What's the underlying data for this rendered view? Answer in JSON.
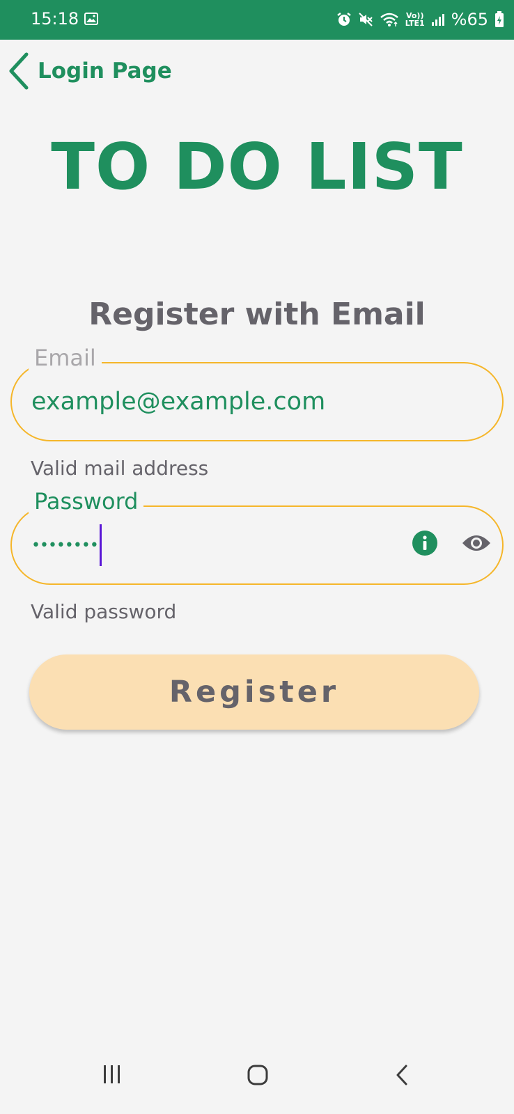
{
  "status_bar": {
    "time": "15:18",
    "volte_top": "Vo))",
    "volte_bottom": "LTE1",
    "battery": "%65",
    "icons": [
      "gallery-icon",
      "alarm-icon",
      "mute-icon",
      "wifi-icon",
      "volte-icon",
      "signal-icon",
      "battery-icon"
    ]
  },
  "header": {
    "back_label": "Login Page",
    "app_title": "TO DO LIST"
  },
  "form": {
    "heading": "Register with Email",
    "email": {
      "label": "Email",
      "value": "example@example.com",
      "helper": "Valid mail address"
    },
    "password": {
      "label": "Password",
      "masked_value": "••••••••",
      "helper": "Valid password"
    },
    "submit_label": "Register"
  },
  "colors": {
    "primary": "#1f8f5e",
    "field_border": "#f5b62a",
    "button_bg": "#fbdfb3",
    "text_gray": "#65636a",
    "background": "#f4f4f4",
    "caret": "#5a17d6"
  },
  "nav_bar": {
    "icons": [
      "recent-apps-icon",
      "home-icon",
      "back-icon"
    ]
  }
}
